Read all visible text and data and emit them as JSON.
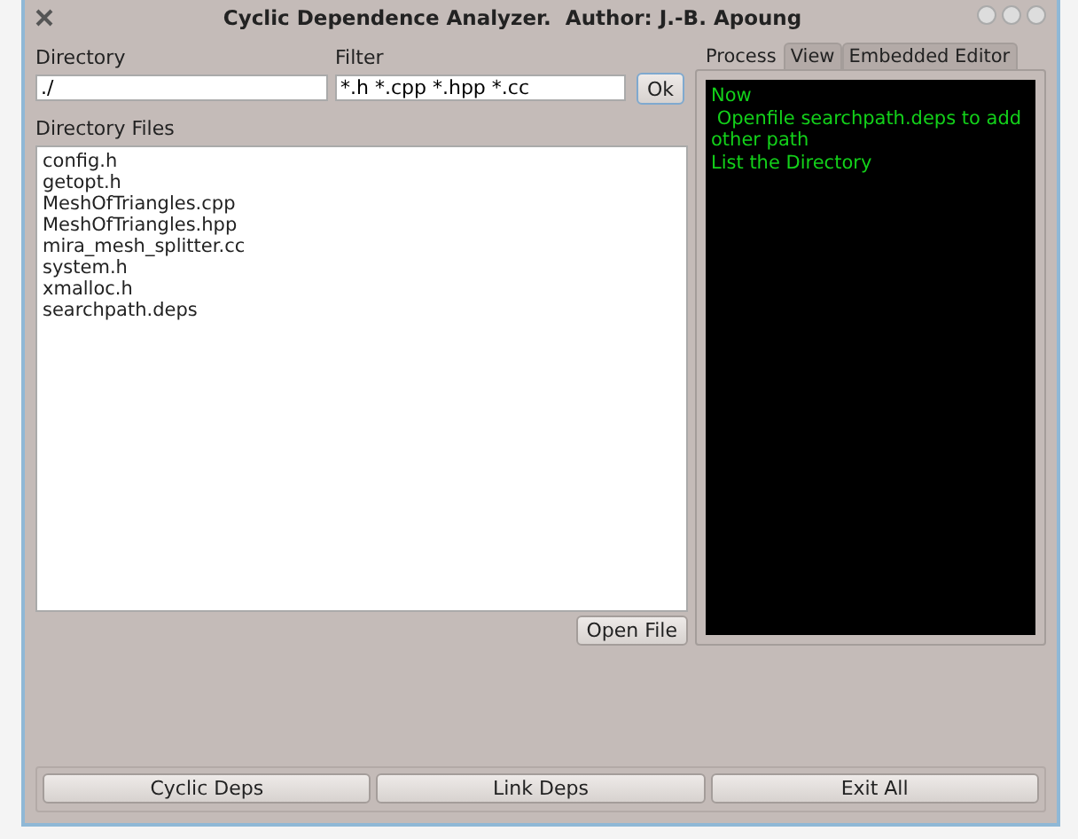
{
  "window": {
    "title": "Cyclic Dependence Analyzer.  Author: J.-B. Apoung"
  },
  "directory": {
    "label": "Directory",
    "value": "./"
  },
  "filter": {
    "label": "Filter",
    "value": "*.h *.cpp *.hpp *.cc",
    "button": "Ok"
  },
  "files": {
    "label": "Directory Files",
    "items": [
      "config.h",
      "getopt.h",
      "MeshOfTriangles.cpp",
      "MeshOfTriangles.hpp",
      "mira_mesh_splitter.cc",
      "system.h",
      "xmalloc.h",
      "searchpath.deps"
    ],
    "button": "Open File"
  },
  "tabs": [
    {
      "label": "Process",
      "selected": true
    },
    {
      "label": "View",
      "selected": false
    },
    {
      "label": "Embedded Editor",
      "selected": false
    }
  ],
  "console": {
    "lines": [
      "Now",
      " Openfile searchpath.deps to add other path",
      "List the Directory"
    ]
  },
  "buttons": [
    "Cyclic Deps",
    "Link Deps",
    "Exit All"
  ]
}
